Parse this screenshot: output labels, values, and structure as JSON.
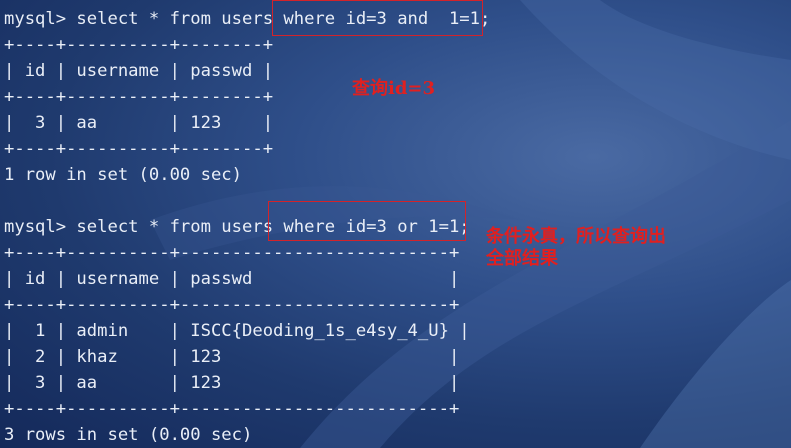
{
  "terminal": {
    "lines": [
      "mysql> select * from users where id=3 and  1=1;",
      "+----+----------+--------+",
      "| id | username | passwd |",
      "+----+----------+--------+",
      "|  3 | aa       | 123    |",
      "+----+----------+--------+",
      "1 row in set (0.00 sec)",
      "",
      "mysql> select * from users where id=3 or 1=1;",
      "+----+----------+--------------------------+",
      "| id | username | passwd                   |",
      "+----+----------+--------------------------+",
      "|  1 | admin    | ISCC{Deoding_1s_e4sy_4_U} |",
      "|  2 | khaz     | 123                      |",
      "|  3 | aa       | 123                      |",
      "+----+----------+--------------------------+",
      "3 rows in set (0.00 sec)"
    ]
  },
  "annotations": {
    "note1": "查询id=3",
    "note2_line1": "条件永真，所以查询出",
    "note2_line2": "全部结果"
  },
  "colors": {
    "terminal_text": "#e9eef7",
    "annotation_red": "#e02020",
    "background": "#2f4f8a"
  }
}
